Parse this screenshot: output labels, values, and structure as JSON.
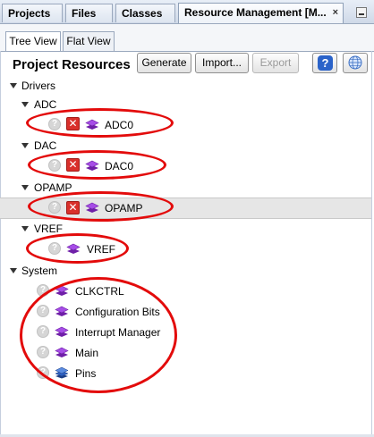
{
  "tabs": [
    {
      "label": "Projects"
    },
    {
      "label": "Files"
    },
    {
      "label": "Classes"
    },
    {
      "label": "Resource Management [M...",
      "close": "×"
    }
  ],
  "subtabs": [
    {
      "label": "Tree View"
    },
    {
      "label": "Flat View"
    }
  ],
  "toolbar": {
    "title": "Project Resources",
    "generate": "Generate",
    "import": "Import...",
    "export": "Export",
    "help_glyph": "?"
  },
  "tree": {
    "drivers": "Drivers",
    "adc": "ADC",
    "adc0": "ADC0",
    "dac": "DAC",
    "dac0": "DAC0",
    "opamp_group": "OPAMP",
    "opamp": "OPAMP",
    "vref_group": "VREF",
    "vref": "VREF",
    "system": "System",
    "clkctrl": "CLKCTRL",
    "config_bits": "Configuration Bits",
    "interrupt_manager": "Interrupt Manager",
    "main": "Main",
    "pins": "Pins"
  },
  "colors": {
    "highlight_ellipse": "#e30b0b",
    "error_icon": "#d9302b",
    "module_layer_purple": "#9b3bd8",
    "pins_layer_blue": "#2d5fc0"
  },
  "icons": {
    "help": "help-circle-icon",
    "error": "error-x-icon",
    "module": "layers-icon"
  }
}
